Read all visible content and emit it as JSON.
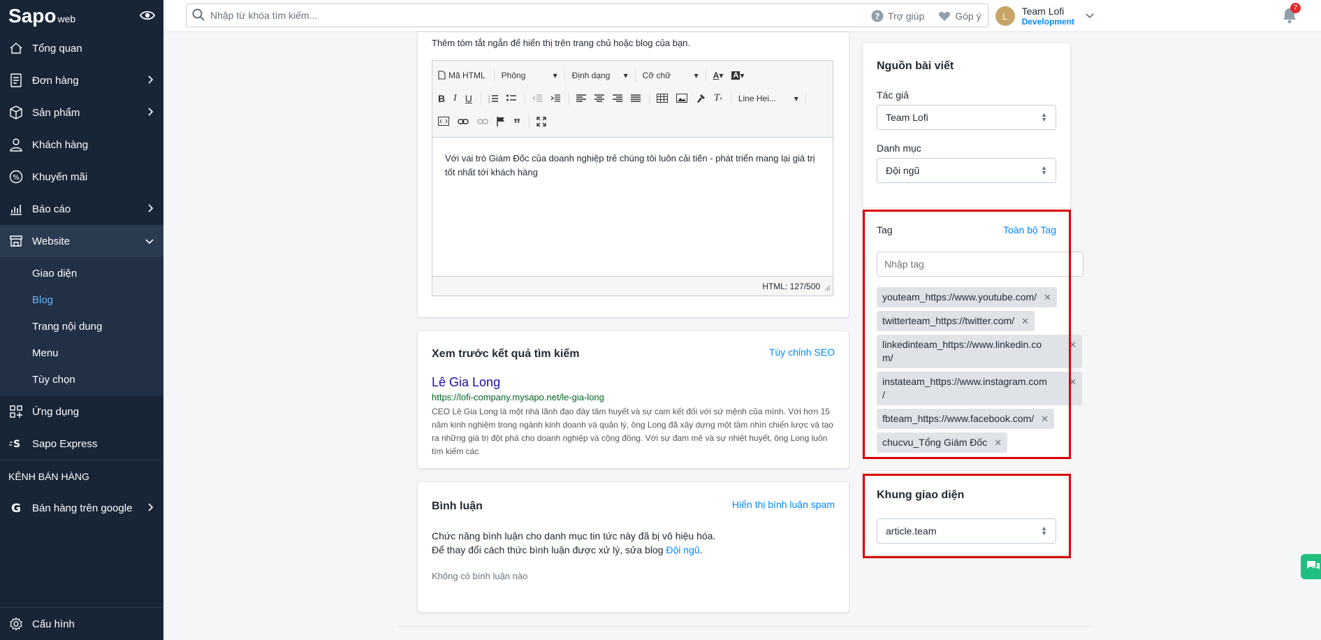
{
  "brand": {
    "name": "Sapo",
    "suffix": "web"
  },
  "sidebar": {
    "items": [
      {
        "label": "Tổng quan"
      },
      {
        "label": "Đơn hàng"
      },
      {
        "label": "Sản phẩm"
      },
      {
        "label": "Khách hàng"
      },
      {
        "label": "Khuyến mãi"
      },
      {
        "label": "Báo cáo"
      },
      {
        "label": "Website"
      },
      {
        "label": "Ứng dụng"
      },
      {
        "label": "Sapo Express"
      }
    ],
    "website_sub": [
      {
        "label": "Giao diện"
      },
      {
        "label": "Blog"
      },
      {
        "label": "Trang nội dung"
      },
      {
        "label": "Menu"
      },
      {
        "label": "Tùy chọn"
      }
    ],
    "channel_label": "KÊNH BÁN HÀNG",
    "google": "Bán hàng trên google",
    "settings": "Cấu hình"
  },
  "topbar": {
    "search_placeholder": "Nhập từ khóa tìm kiếm...",
    "help": "Trợ giúp",
    "feedback": "Góp ý",
    "avatar_letter": "L",
    "user_name": "Team Lofi",
    "user_role": "Development",
    "notif_count": "7"
  },
  "excerpt": {
    "hint": "Thêm tóm tắt ngắn để hiển thị trên trang chủ hoặc blog của bạn.",
    "toolbar": {
      "html": "Mã HTML",
      "font": "Phông",
      "format": "Định dạng",
      "size": "Cỡ chữ",
      "line_height": "Line Hei..."
    },
    "content": "Với vai trò Giám Đốc của doanh nghiệp trẻ chúng tôi luôn cải tiến - phát triển mang lại giá trị tốt nhất tới khách hàng",
    "counter": "HTML: 127/500"
  },
  "seo": {
    "title": "Xem trước kết quả tìm kiếm",
    "customize": "Tùy chỉnh SEO",
    "page_title": "Lê Gia Long",
    "url": "https://lofi-company.mysapo.net/le-gia-long",
    "description": "CEO Lê Gia Long là một nhà lãnh đạo đầy tâm huyết và sự cam kết đối với sứ mệnh của mình. Với hơn 15 năm kinh nghiệm trong ngành kinh doanh và quản lý, ông Long đã xây dựng một tầm nhìn chiến lược và tạo ra những giá trị đột phá cho doanh nghiệp và cộng đồng. Với sự đam mê và sự nhiệt huyết, ông Long luôn tìm kiếm các"
  },
  "comments": {
    "title": "Bình luận",
    "spam_link": "Hiển thị bình luận spam",
    "line1": "Chức năng bình luận cho danh mục tin tức này đã bị vô hiệu hóa.",
    "line2_pre": "Để thay đổi cách thức bình luận được xử lý, sửa blog",
    "line2_link": "Đội ngũ",
    "line2_post": ".",
    "none": "Không có bình luận nào"
  },
  "source": {
    "title": "Nguồn bài viết",
    "author_label": "Tác giả",
    "author_value": "Team Lofi",
    "category_label": "Danh mục",
    "category_value": "Đội ngũ"
  },
  "tags": {
    "label": "Tag",
    "all_link": "Toàn bộ Tag",
    "input_placeholder": "Nhập tag",
    "items": [
      {
        "l1": "youteam_https://www.youtube.com/",
        "l2": ""
      },
      {
        "l1": "twitterteam_https://twitter.com/",
        "l2": ""
      },
      {
        "l1": "linkedinteam_https://www.linkedin.co",
        "l2": "m/"
      },
      {
        "l1": "instateam_https://www.instagram.com",
        "l2": "/"
      },
      {
        "l1": "fbteam_https://www.facebook.com/",
        "l2": ""
      },
      {
        "l1": "chucvu_Tổng Giám Đốc",
        "l2": ""
      }
    ]
  },
  "layout_frame": {
    "title": "Khung giao diện",
    "value": "article.team"
  },
  "colors": {
    "sidebar": "#182537",
    "accent": "#0088ff",
    "highlight": "#d80000"
  }
}
